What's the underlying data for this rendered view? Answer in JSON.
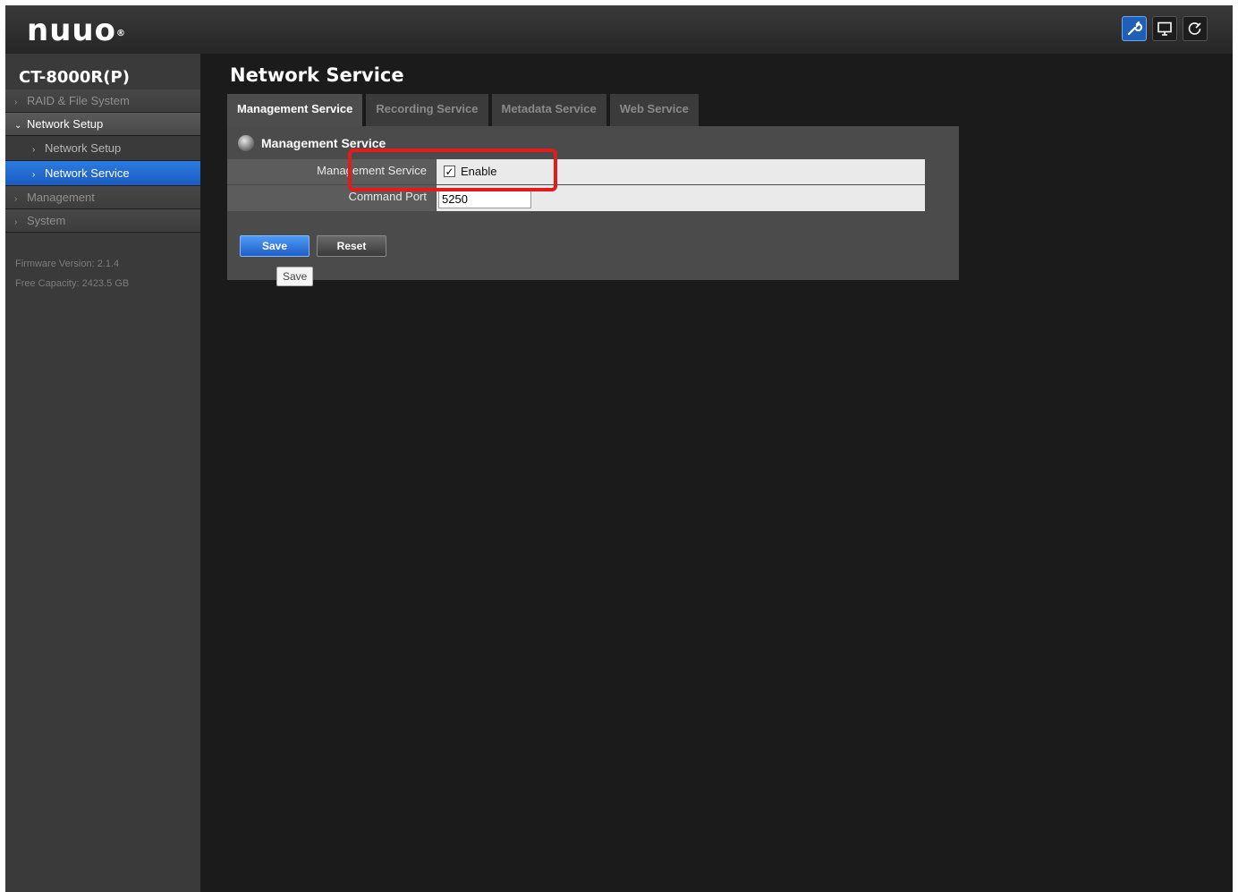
{
  "header": {
    "logo_text": "nuuo",
    "logo_mark": "®",
    "icons": [
      "wrench-icon",
      "monitor-icon",
      "power-icon"
    ]
  },
  "sidebar": {
    "device_name": "CT-8000R(P)",
    "items": [
      {
        "label": "RAID & File System"
      },
      {
        "label": "Network Setup"
      },
      {
        "label": "Network Setup"
      },
      {
        "label": "Network Service"
      },
      {
        "label": "Management"
      },
      {
        "label": "System"
      }
    ],
    "firmware": "Firmware Version: 2.1.4",
    "capacity": "Free Capacity: 2423.5 GB"
  },
  "main": {
    "title": "Network Service",
    "tabs": [
      {
        "label": "Management Service"
      },
      {
        "label": "Recording Service"
      },
      {
        "label": "Metadata Service"
      },
      {
        "label": "Web Service"
      }
    ],
    "section_title": "Management Service",
    "fields": {
      "service_label": "Management Service",
      "service_checked": true,
      "service_value": "Enable",
      "port_label": "Command Port",
      "port_value": "5250"
    },
    "buttons": {
      "save": "Save",
      "reset": "Reset"
    },
    "tooltip": "Save"
  },
  "colors": {
    "accent": "#1f5ec8",
    "highlight": "#e41b1b",
    "background": "#1b1b1b"
  }
}
